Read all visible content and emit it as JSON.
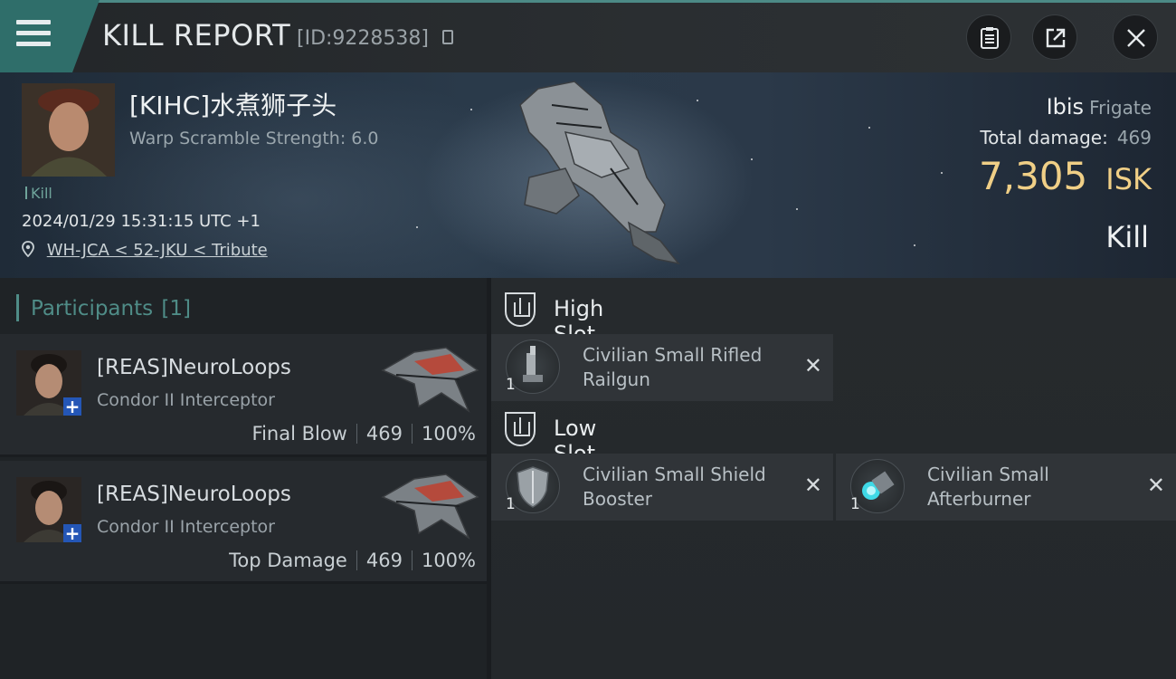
{
  "header": {
    "title": "KILL REPORT",
    "kill_id": "[ID:9228538]"
  },
  "victim": {
    "name": "[KIHC]水煮狮子头",
    "warp_scramble": "Warp Scramble Strength: 6.0",
    "tag": "Kill",
    "datetime": "2024/01/29 15:31:15 UTC +1",
    "location": "WH-JCA < 52-JKU < Tribute",
    "ship_name": "Ibis",
    "ship_class": "Frigate",
    "total_damage_label": "Total damage:",
    "total_damage": "469",
    "isk_value": "7,305",
    "isk_unit": "ISK",
    "result": "Kill"
  },
  "participants": {
    "label": "Participants",
    "count": "[1]",
    "rows": [
      {
        "name": "[REAS]NeuroLoops",
        "ship": "Condor II Interceptor",
        "role": "Final Blow",
        "damage": "469",
        "percent": "100%"
      },
      {
        "name": "[REAS]NeuroLoops",
        "ship": "Condor II Interceptor",
        "role": "Top Damage",
        "damage": "469",
        "percent": "100%"
      }
    ]
  },
  "fitting": {
    "high_slot_label": "High Slot",
    "low_slot_label": "Low Slot",
    "high_modules": [
      {
        "name": "Civilian Small Rifled Railgun",
        "qty": "1",
        "icon": "railgun-icon"
      }
    ],
    "low_modules": [
      {
        "name": "Civilian Small Shield Booster",
        "qty": "1",
        "icon": "shield-booster-icon"
      },
      {
        "name": "Civilian Small Afterburner",
        "qty": "1",
        "icon": "afterburner-icon"
      }
    ]
  },
  "colors": {
    "accent_teal": "#4f8c87",
    "isk_gold": "#f0cf86",
    "badge_blue": "#2456b6"
  }
}
